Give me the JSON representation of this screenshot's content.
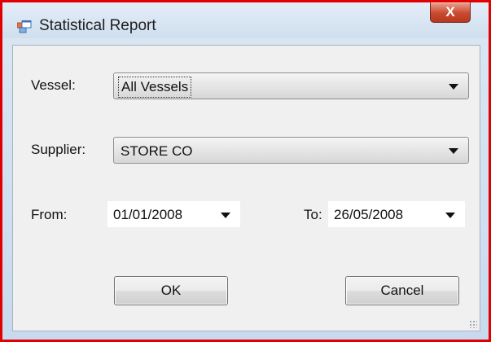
{
  "window": {
    "title": "Statistical Report",
    "close_glyph": "X",
    "border_color": "#e00000"
  },
  "form": {
    "vessel_label": "Vessel:",
    "vessel_value": "All Vessels",
    "supplier_label": "Supplier:",
    "supplier_value": "STORE CO",
    "from_label": "From:",
    "from_value": "01/01/2008",
    "to_label": "To:",
    "to_value": "26/05/2008"
  },
  "buttons": {
    "ok_label": "OK",
    "cancel_label": "Cancel"
  },
  "icons": {
    "app": "form-window-icon",
    "dropdown": "chevron-down-icon",
    "resize": "resize-grip-icon"
  }
}
